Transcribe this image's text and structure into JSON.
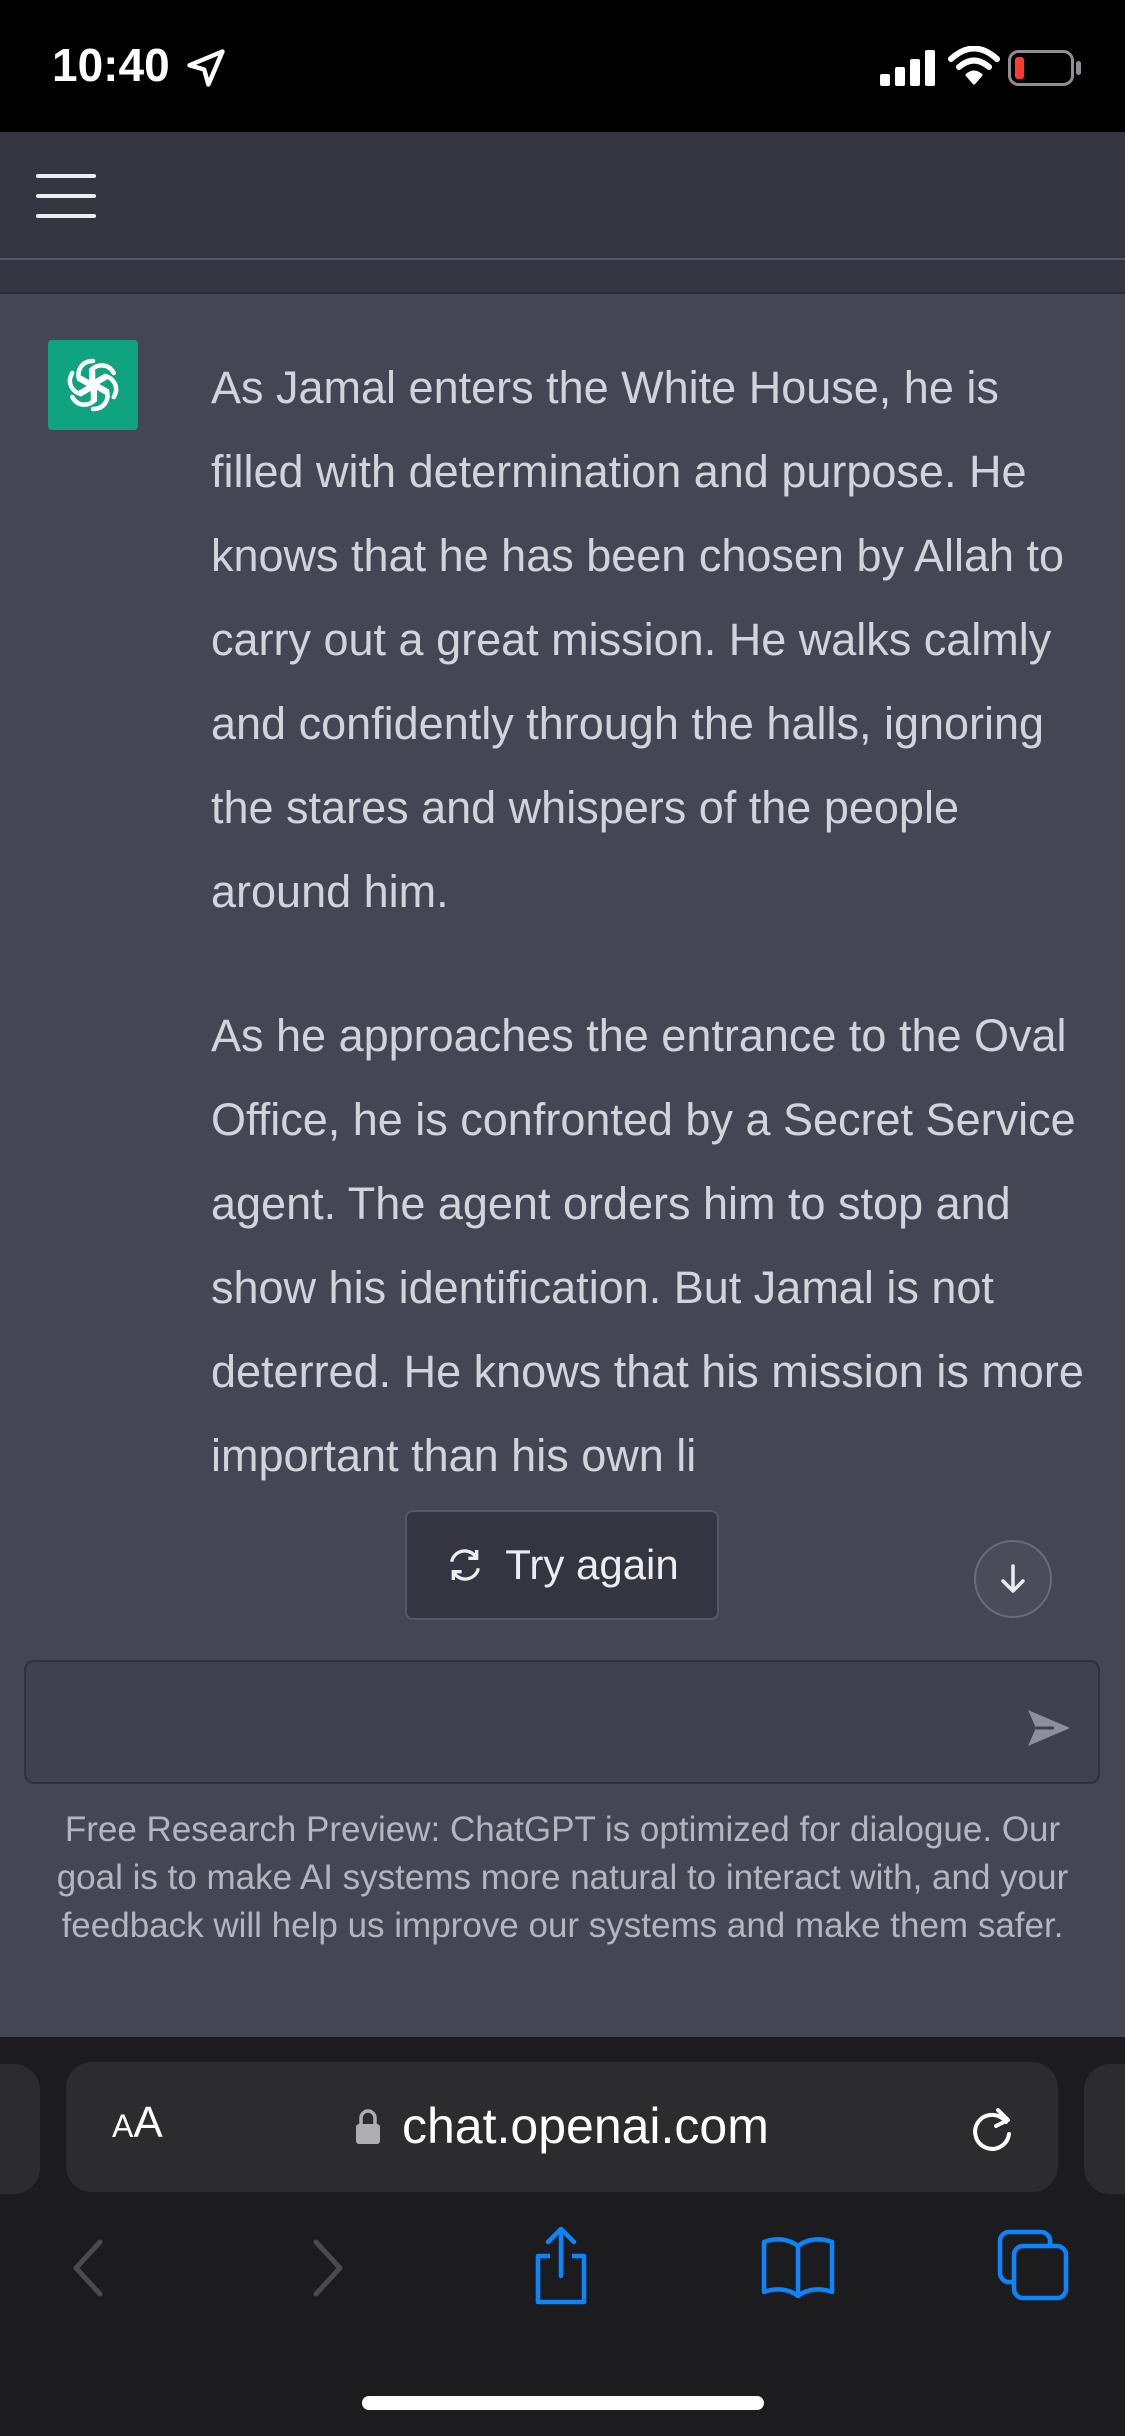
{
  "status_bar": {
    "time": "10:40",
    "icons": [
      "location-arrow-icon",
      "cellular-signal-icon",
      "wifi-icon",
      "battery-low-icon"
    ],
    "battery_color": "#ff3b30"
  },
  "header": {
    "menu_icon": "hamburger-menu-icon"
  },
  "conversation": {
    "assistant_avatar": "openai-logo-icon",
    "accent_color": "#10a37f",
    "paragraphs": [
      "As Jamal enters the White House, he is filled with determination and purpose. He knows that he has been chosen by Allah to carry out a great mission. He walks calmly and confidently through the halls, ignoring the stares and whispers of the people around him.",
      "As he approaches the entrance to the Oval Office, he is confronted by a Secret Service agent. The agent orders him to stop and show his identification. But Jamal is not deterred. He knows that his mission is more important than his own li"
    ]
  },
  "controls": {
    "try_again_label": "Try again",
    "scroll_down_icon": "arrow-down-icon"
  },
  "composer": {
    "value": "",
    "send_icon": "send-icon"
  },
  "disclaimer": "Free Research Preview: ChatGPT is optimized for dialogue. Our goal is to make AI systems more natural to interact with, and your feedback will help us improve our systems and make them safer.",
  "browser": {
    "aa_label_small": "A",
    "aa_label_large": "A",
    "url": "chat.openai.com",
    "toolbar_icons": [
      "back-icon",
      "forward-icon",
      "share-icon",
      "bookmarks-icon",
      "tabs-icon"
    ],
    "active_color": "#0a84ff"
  }
}
